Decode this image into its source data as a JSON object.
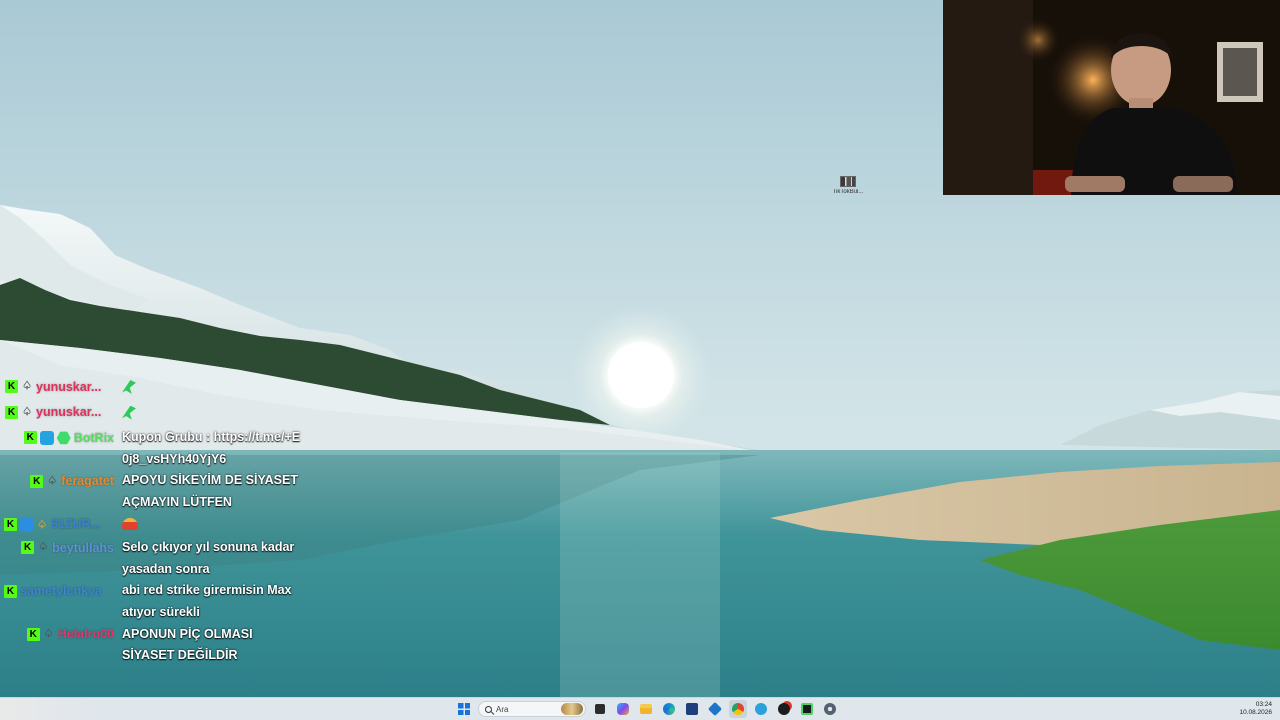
{
  "desktop": {
    "icon_label": "TikTokBul..."
  },
  "chat": {
    "messages": [
      {
        "user": "yunuskar...",
        "user_color": "#e0315c",
        "text": "",
        "emote": "green"
      },
      {
        "user": "yunuskar...",
        "user_color": "#e0315c",
        "text": "",
        "emote": "green"
      },
      {
        "user": "BotRix",
        "user_color": "#52e05a",
        "text": "Kupon Grubu : https://t.me/+E0j8_vsHYh40YjY6"
      },
      {
        "user": "feragatet",
        "user_color": "#e3882f",
        "text": "APOYU SİKEYİM DE SİYASET AÇMAYIN LÜTFEN"
      },
      {
        "user": "31ZUR...",
        "user_color": "#3a7fd6",
        "text": "",
        "emote": "red"
      },
      {
        "user": "beytullahs",
        "user_color": "#5f8fd9",
        "text": "Selo çıkıyor yıl sonuna kadar yasadan sonra"
      },
      {
        "user": "sametylcnkya",
        "user_color": "#3e82d0",
        "text": "abi red strike girermisin Max atıyor sürekli"
      },
      {
        "user": "Helalro00",
        "user_color": "#e23568",
        "text": "APONUN PİÇ OLMASI SİYASET DEĞİLDİR"
      }
    ]
  },
  "taskbar": {
    "search_placeholder": "Ara",
    "apps": [
      "start-icon",
      "search",
      "file-manager-icon",
      "copilot-icon",
      "folder-icon",
      "edge-icon",
      "store-icon",
      "vpn-icon",
      "chrome-icon",
      "telegram-icon",
      "kick-icon",
      "game-icon",
      "settings-icon"
    ],
    "clock_time": "03:24",
    "clock_date": "10.08.2026"
  }
}
